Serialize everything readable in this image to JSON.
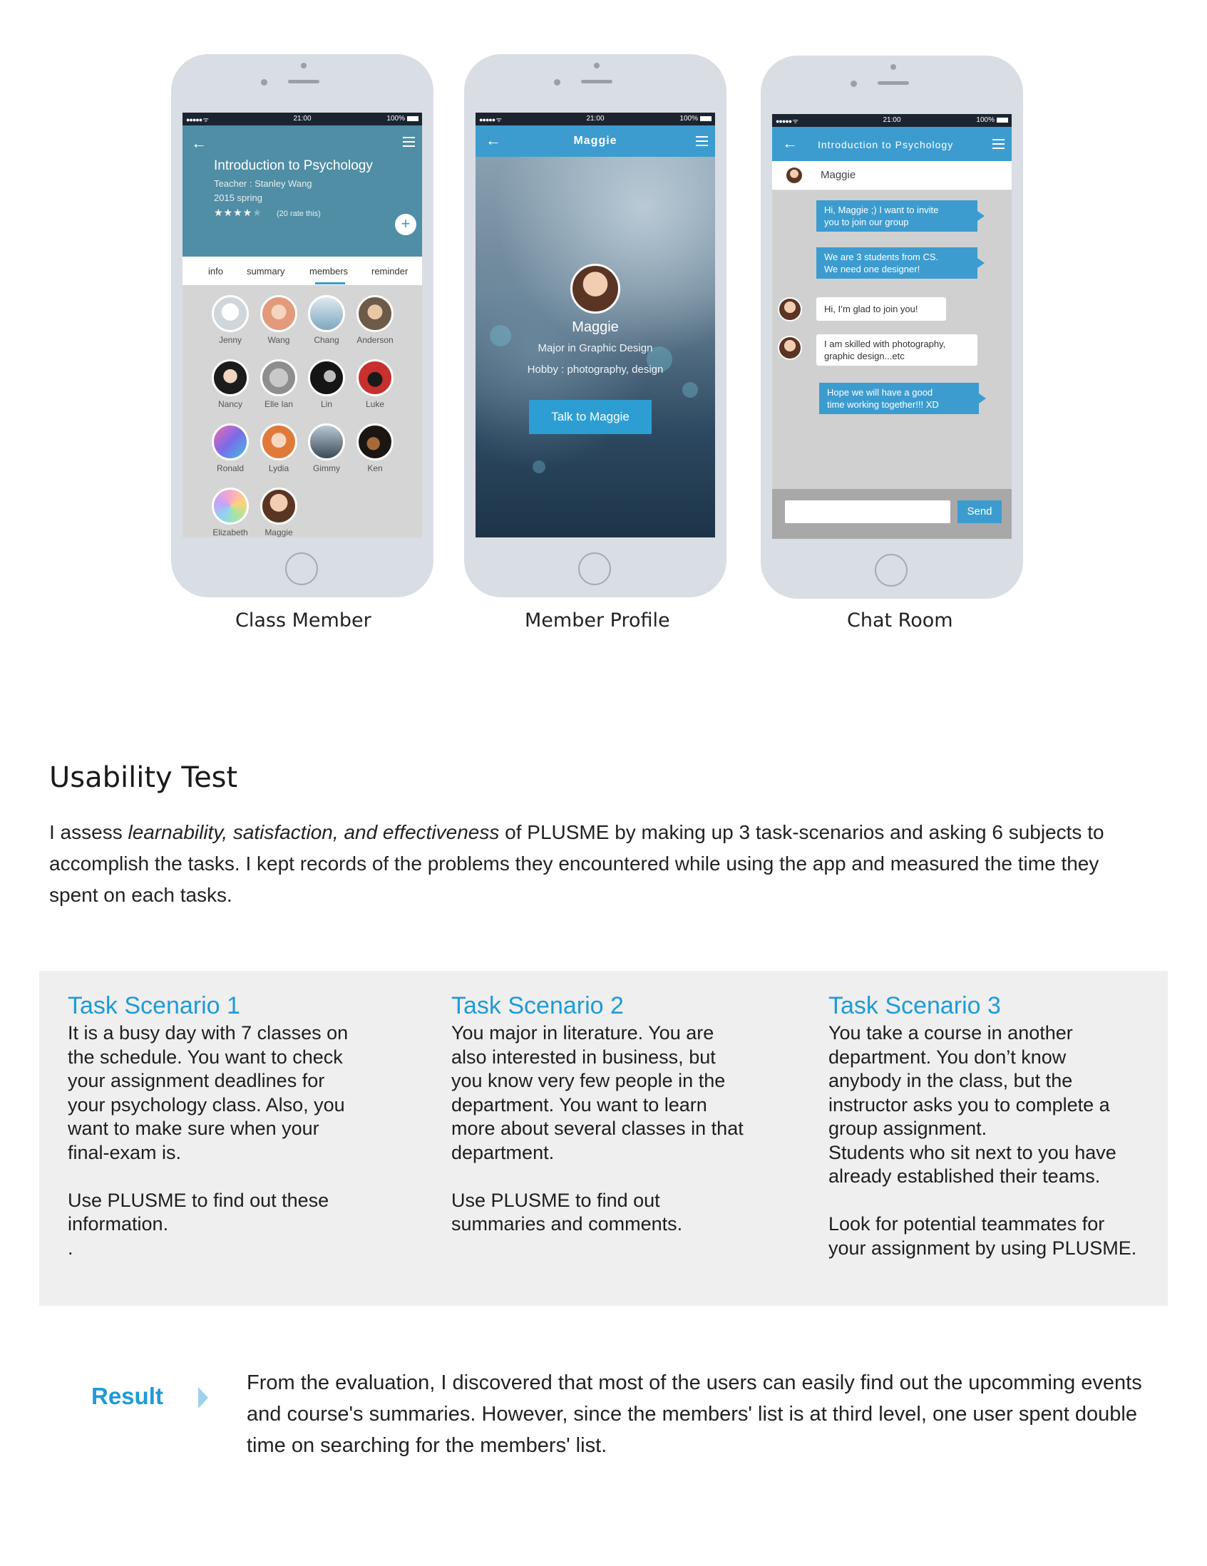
{
  "phones": {
    "status": {
      "signal": "●●●●● ᯤ",
      "time": "21:00",
      "battery": "100%"
    },
    "class_member": {
      "caption": "Class Member",
      "course_title": "Introduction to Psychology",
      "teacher": "Teacher : Stanley Wang",
      "term": "2015 spring",
      "stars": "★★★★",
      "star_dim": "★",
      "rate": "(20 rate this)",
      "tabs": [
        "info",
        "summary",
        "members",
        "reminder"
      ],
      "members": [
        "Jenny",
        "Wang",
        "Chang",
        "Anderson",
        "Nancy",
        "Elle Ian",
        "Lin",
        "Luke",
        "Ronald",
        "Lydia",
        "Gimmy",
        "Ken",
        "Elizabeth",
        "Maggie"
      ]
    },
    "member_profile": {
      "caption": "Member Profile",
      "nav_title": "Maggie",
      "name": "Maggie",
      "major": "Major in Graphic Design",
      "hobby": "Hobby : photography, design",
      "button": "Talk to Maggie"
    },
    "chat_room": {
      "caption": "Chat Room",
      "nav_title": "Introduction to Psychology",
      "member": "Maggie",
      "messages": [
        "Hi, Maggie ;)    I want to invite\n you to join our group",
        "We are 3 students from CS.\nWe need one designer!",
        "Hi, I’m glad to join you!",
        "I am skilled with photography,\ngraphic design...etc",
        "Hope we will have a good\ntime working together!!! XD"
      ],
      "send": "Send"
    }
  },
  "usability": {
    "heading": "Usability Test",
    "intro_pre": "I assess ",
    "intro_em": "learnability, satisfaction, and effectiveness",
    "intro_post": " of PLUSME by making up 3 task-scenarios and asking 6 subjects to accomplish the tasks. I kept records of the problems they encountered while using the app and measured the time they spent on each tasks."
  },
  "scenarios": [
    {
      "title": "Task Scenario 1",
      "body": "It is a busy day with 7 classes on\nthe schedule. You want to check\nyour assignment deadlines for\nyour psychology class. Also, you\nwant to make sure when your\nfinal-exam is.\n\nUse PLUSME to find out these\ninformation.\n."
    },
    {
      "title": "Task Scenario 2",
      "body": "You major in literature. You are\nalso interested in business, but\nyou know very few people in the\ndepartment. You want to learn\nmore about several classes in that\ndepartment.\n\nUse PLUSME to find out\nsummaries and comments."
    },
    {
      "title": "Task Scenario 3",
      "body": "You take a course in another\ndepartment. You don’t know\nanybody in the class, but the\ninstructor asks you to complete a\ngroup assignment.\nStudents who sit next to you have\nalready established their teams.\n\nLook for potential teammates for\nyour assignment by using PLUSME."
    }
  ],
  "result": {
    "label": "Result",
    "text": "From the evaluation, I discovered that most of the users can easily find out the upcomming events and course's summaries. However, since the members' list is at third level, one user spent double time on searching for the members' list."
  },
  "colors": {
    "accent": "#1e9bd7",
    "app_blue": "#3c9ccf",
    "phone_body": "#d9dde4",
    "panel": "#efefef"
  }
}
